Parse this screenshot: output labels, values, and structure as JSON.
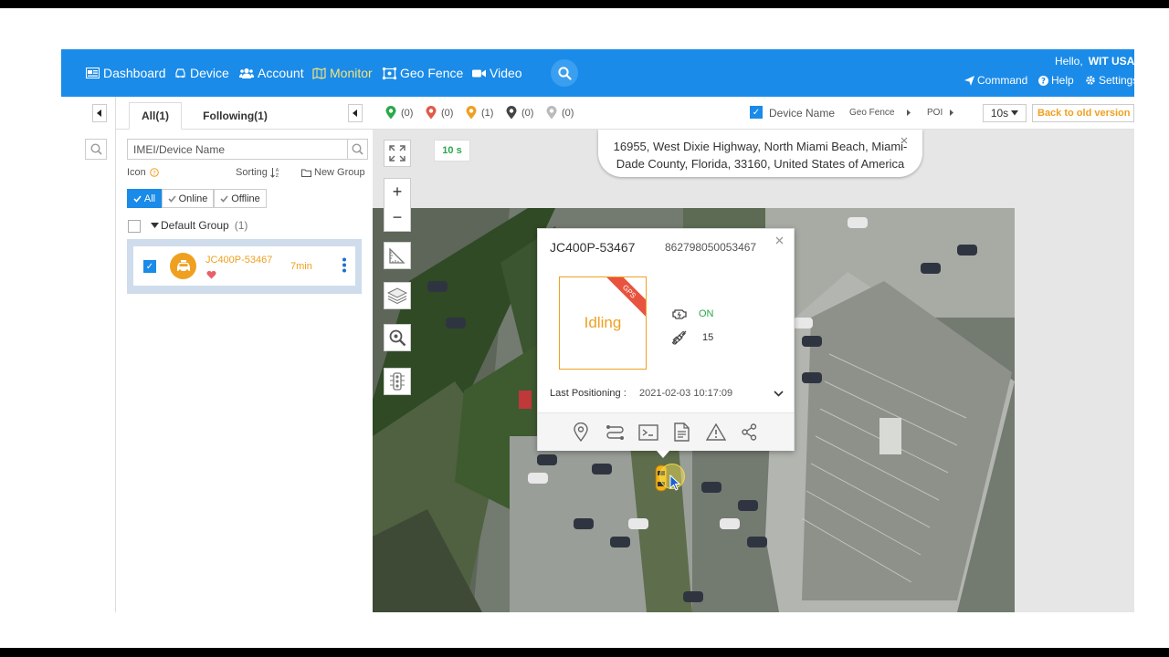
{
  "nav": {
    "items": [
      {
        "label": "Dashboard",
        "icon": "dashboard-icon"
      },
      {
        "label": "Device",
        "icon": "car-icon"
      },
      {
        "label": "Account",
        "icon": "users-icon"
      },
      {
        "label": "Monitor",
        "icon": "map-icon"
      },
      {
        "label": "Geo Fence",
        "icon": "geofence-icon"
      },
      {
        "label": "Video",
        "icon": "video-icon"
      }
    ],
    "hello": "Hello,",
    "user": "WIT USA",
    "command": "Command",
    "help": "Help",
    "settings": "Settings"
  },
  "left": {
    "tab_all": "All(1)",
    "tab_following": "Following(1)",
    "search_placeholder": "IMEI/Device Name",
    "icon_label": "Icon",
    "sorting_label": "Sorting",
    "new_group": "New Group",
    "filters": [
      "All",
      "Online",
      "Offline"
    ],
    "group_name": "Default Group",
    "group_count": "(1)",
    "device": {
      "name": "JC400P-53467",
      "time": "7min"
    }
  },
  "toolbar": {
    "markers": [
      {
        "count": "(0)",
        "color": "#2aa84a"
      },
      {
        "count": "(0)",
        "color": "#e05a4a"
      },
      {
        "count": "(1)",
        "color": "#f0a020"
      },
      {
        "count": "(0)",
        "color": "#444444"
      },
      {
        "count": "(0)",
        "color": "#bbbbbb"
      }
    ],
    "device_name_label": "Device Name",
    "geo_fence": "Geo Fence",
    "poi": "POI",
    "interval": "10s",
    "back_old": "Back to old version"
  },
  "map": {
    "refresh_badge": "10 s",
    "address_line1": "16955, West Dixie Highway, North Miami Beach, Miami-",
    "address_line2": "Dade County, Florida, 33160, United States of America",
    "popup": {
      "device_name": "JC400P-53467",
      "imei": "862798050053467",
      "status": "Idling",
      "ribbon": "GPS",
      "acc": "ON",
      "satellites": "15",
      "last_pos_label": "Last Positioning :",
      "last_pos_time": "2021-02-03 10:17:09"
    }
  },
  "colors": {
    "nav": "#1a8be8",
    "accent": "#f0a020",
    "on": "#2aa84a"
  }
}
